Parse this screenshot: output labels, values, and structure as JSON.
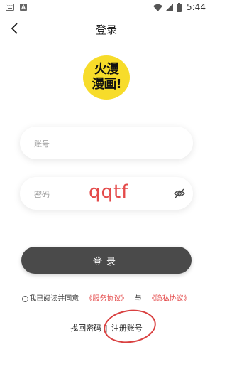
{
  "status_bar": {
    "time": "5:44",
    "icons": [
      "keyboard-icon",
      "a-icon",
      "wifi-icon",
      "signal-icon",
      "battery-icon"
    ]
  },
  "header": {
    "title": "登录",
    "back_icon": "chevron-left-icon"
  },
  "logo": {
    "line1": "火漫",
    "line2": "漫画!",
    "color": "#f7dc2a"
  },
  "form": {
    "account_placeholder": "账号",
    "account_value": "",
    "password_placeholder": "密码",
    "password_value": "",
    "password_annotation": "qqtf"
  },
  "login_button": {
    "label": "登录",
    "color": "#4a4a4a"
  },
  "agreement": {
    "prefix": "我已阅读并同意",
    "service_link": "《服务协议》",
    "conjunction": "与",
    "privacy_link": "《隐私协议》",
    "link_color": "#e44a4a"
  },
  "bottom_links": {
    "forgot_password": "找回密码",
    "divider": "|",
    "register": "注册账号"
  }
}
